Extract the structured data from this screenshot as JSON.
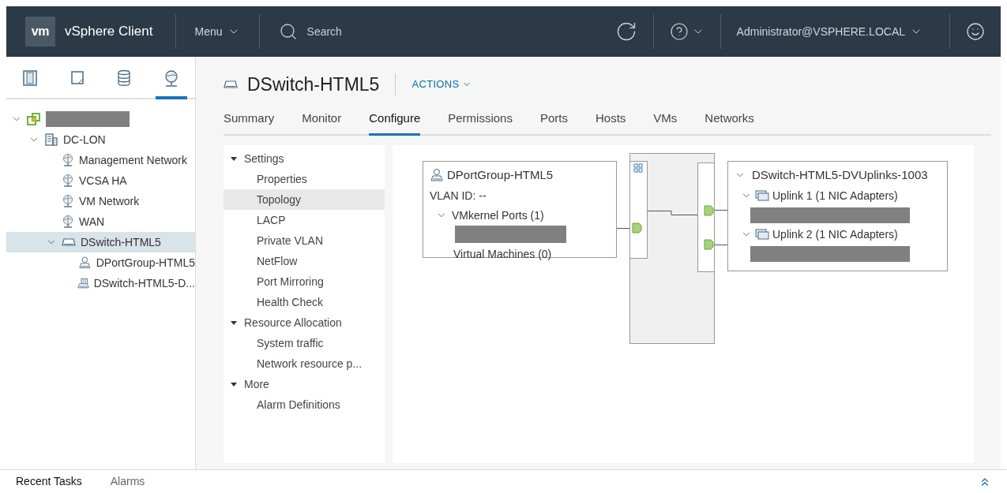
{
  "header": {
    "logo": "vm",
    "title": "vSphere Client",
    "menu": "Menu",
    "search": {
      "placeholder": "Search"
    },
    "user": "Administrator@VSPHERE.LOCAL"
  },
  "sidebar": {
    "view_tabs": [
      {
        "kind": "hosts",
        "selected": false
      },
      {
        "kind": "vms",
        "selected": false
      },
      {
        "kind": "storage",
        "selected": false
      },
      {
        "kind": "network",
        "selected": true
      }
    ],
    "tree": [
      {
        "kind": "vcenter",
        "redacted": true,
        "expanded": true,
        "selected": false,
        "children": [
          {
            "kind": "datacenter",
            "label": "DC-LON",
            "expanded": true,
            "selected": false,
            "children": [
              {
                "kind": "network",
                "label": "Management Network",
                "selected": false
              },
              {
                "kind": "network",
                "label": "VCSA HA",
                "selected": false
              },
              {
                "kind": "network",
                "label": "VM Network",
                "selected": false
              },
              {
                "kind": "network",
                "label": "WAN",
                "selected": false
              },
              {
                "kind": "switch",
                "label": "DSwitch-HTML5",
                "expanded": true,
                "selected": true,
                "children": [
                  {
                    "kind": "portgroup",
                    "label": "DPortGroup-HTML5",
                    "selected": false
                  },
                  {
                    "kind": "uplinks",
                    "label": "DSwitch-HTML5-D...",
                    "selected": false
                  }
                ]
              }
            ]
          }
        ]
      }
    ]
  },
  "main": {
    "title": "DSwitch-HTML5",
    "actions": "ACTIONS",
    "tabs": [
      {
        "label": "Summary",
        "selected": false
      },
      {
        "label": "Monitor",
        "selected": false
      },
      {
        "label": "Configure",
        "selected": true
      },
      {
        "label": "Permissions",
        "selected": false
      },
      {
        "label": "Ports",
        "selected": false
      },
      {
        "label": "Hosts",
        "selected": false
      },
      {
        "label": "VMs",
        "selected": false
      },
      {
        "label": "Networks",
        "selected": false
      }
    ],
    "settings": [
      {
        "label": "Settings",
        "expanded": true,
        "items": [
          {
            "label": "Properties",
            "selected": false
          },
          {
            "label": "Topology",
            "selected": true
          },
          {
            "label": "LACP",
            "selected": false
          },
          {
            "label": "Private VLAN",
            "selected": false
          },
          {
            "label": "NetFlow",
            "selected": false
          },
          {
            "label": "Port Mirroring",
            "selected": false
          },
          {
            "label": "Health Check",
            "selected": false
          }
        ]
      },
      {
        "label": "Resource Allocation",
        "expanded": true,
        "items": [
          {
            "label": "System traffic",
            "selected": false
          },
          {
            "label": "Network resource p...",
            "selected": false
          }
        ]
      },
      {
        "label": "More",
        "expanded": true,
        "items": [
          {
            "label": "Alarm Definitions",
            "selected": false
          }
        ]
      }
    ],
    "topology": {
      "port_group": {
        "name": "DPortGroup-HTML5",
        "vlan": "VLAN ID: --",
        "vmkernel": "VMkernel Ports (1)",
        "vmkernel_expanded": true,
        "vms": "Virtual Machines (0)"
      },
      "uplinks": {
        "name": "DSwitch-HTML5-DVUplinks-1003",
        "expanded": true,
        "items": [
          {
            "label": "Uplink 1 (1 NIC Adapters)",
            "expanded": true
          },
          {
            "label": "Uplink 2 (1 NIC Adapters)",
            "expanded": true
          }
        ]
      }
    }
  },
  "bottom": {
    "tabs": [
      {
        "label": "Recent Tasks",
        "selected": true
      },
      {
        "label": "Alarms",
        "selected": false
      }
    ]
  }
}
